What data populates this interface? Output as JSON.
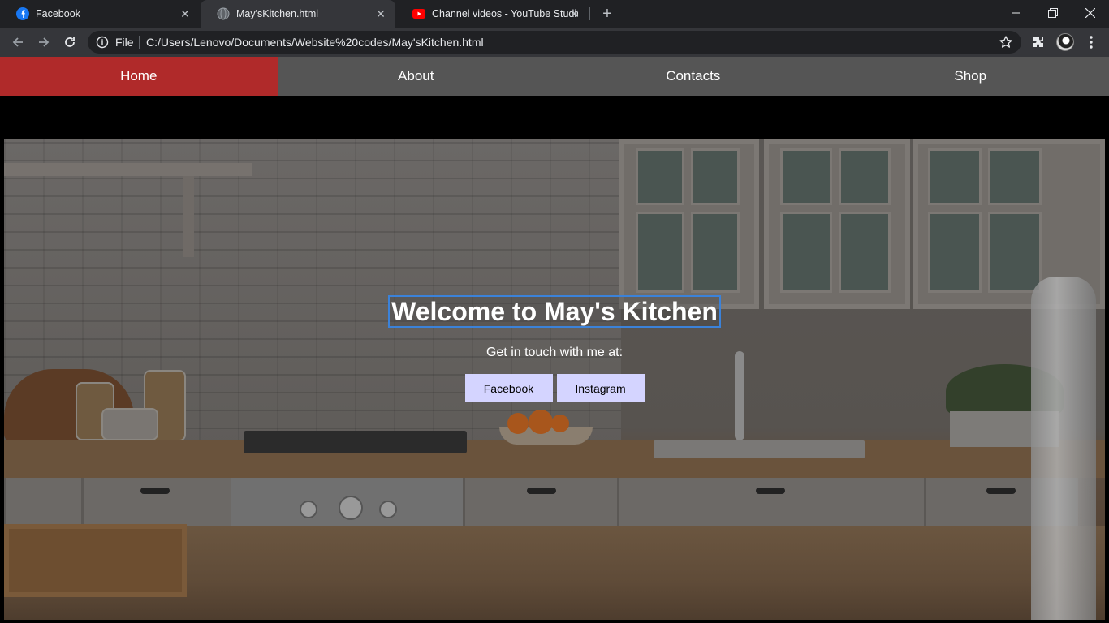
{
  "browser": {
    "tabs": [
      {
        "title": "Facebook",
        "icon": "facebook-icon",
        "active": false
      },
      {
        "title": "May'sKitchen.html",
        "icon": "globe-icon",
        "active": true
      },
      {
        "title": "Channel videos - YouTube Studio",
        "icon": "youtube-icon",
        "active": false
      }
    ],
    "omnibox": {
      "scheme_label": "File",
      "url": "C:/Users/Lenovo/Documents/Website%20codes/May'sKitchen.html"
    }
  },
  "site": {
    "nav": [
      {
        "label": "Home",
        "active": true
      },
      {
        "label": "About",
        "active": false
      },
      {
        "label": "Contacts",
        "active": false
      },
      {
        "label": "Shop",
        "active": false
      }
    ],
    "hero": {
      "title": "Welcome to May's Kitchen",
      "subtitle": "Get in touch with me at:",
      "buttons": [
        {
          "label": "Facebook"
        },
        {
          "label": "Instagram"
        }
      ]
    }
  },
  "colors": {
    "nav_active": "#b02a2a",
    "nav_bg": "#555555",
    "button_bg": "#d4d4ff",
    "title_outline": "#3b82d9"
  }
}
